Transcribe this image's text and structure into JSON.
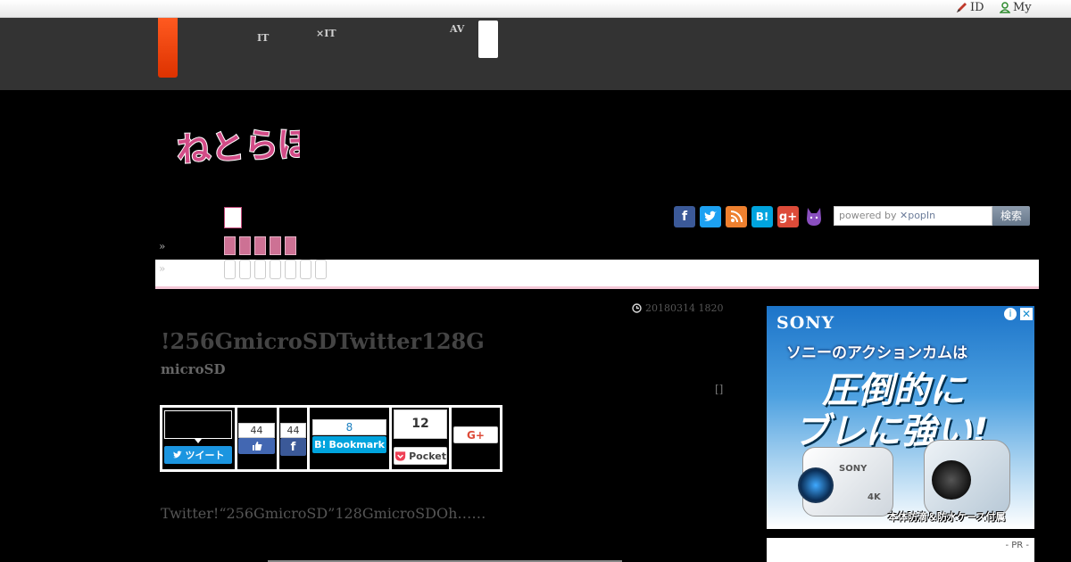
{
  "topbar": {
    "id_label": "ID",
    "my_label": "My"
  },
  "nav": {
    "item1_line1": "",
    "item1_line2": "IT",
    "item2_line1": "",
    "item2_line2": "×IT",
    "item3_line1": "AV",
    "item3_line2": ""
  },
  "header": {
    "logo_text": "ねとらぼ"
  },
  "search": {
    "placeholder_prefix": "powered by",
    "placeholder_brand": "popIn",
    "button_label": "検索"
  },
  "breadcrumb": {
    "sep1": "»",
    "sep2": "»"
  },
  "article": {
    "date": "20180314 1820",
    "title": "!256GmicroSDTwitter128G",
    "subtitle": "microSD",
    "bracket": "[]",
    "excerpt": "Twitter!“256GmicroSD”128GmicroSDOh……"
  },
  "share": {
    "tweet_label": "ツイート",
    "like_count": "44",
    "fb_share_count": "44",
    "hatena_count": "8",
    "hatena_label": "Bookmark",
    "pocket_count": "12",
    "pocket_label": "Pocket",
    "gplus_label": "G+"
  },
  "ad": {
    "brand": "SONY",
    "line1": "ソニーのアクションカムは",
    "line2": "圧倒的に",
    "line3": "ブレに強い!",
    "footer": "本体防滴＆防水ケース付属",
    "camera_brand": "SONY",
    "camera_badge": "4K",
    "pr_label": "- PR -"
  },
  "colors": {
    "accent": "#c24a7a",
    "nav_bg": "#333333",
    "twitter": "#1b95e0",
    "facebook": "#3b5998",
    "hatena": "#00a4de",
    "pocket": "#ef4056"
  }
}
